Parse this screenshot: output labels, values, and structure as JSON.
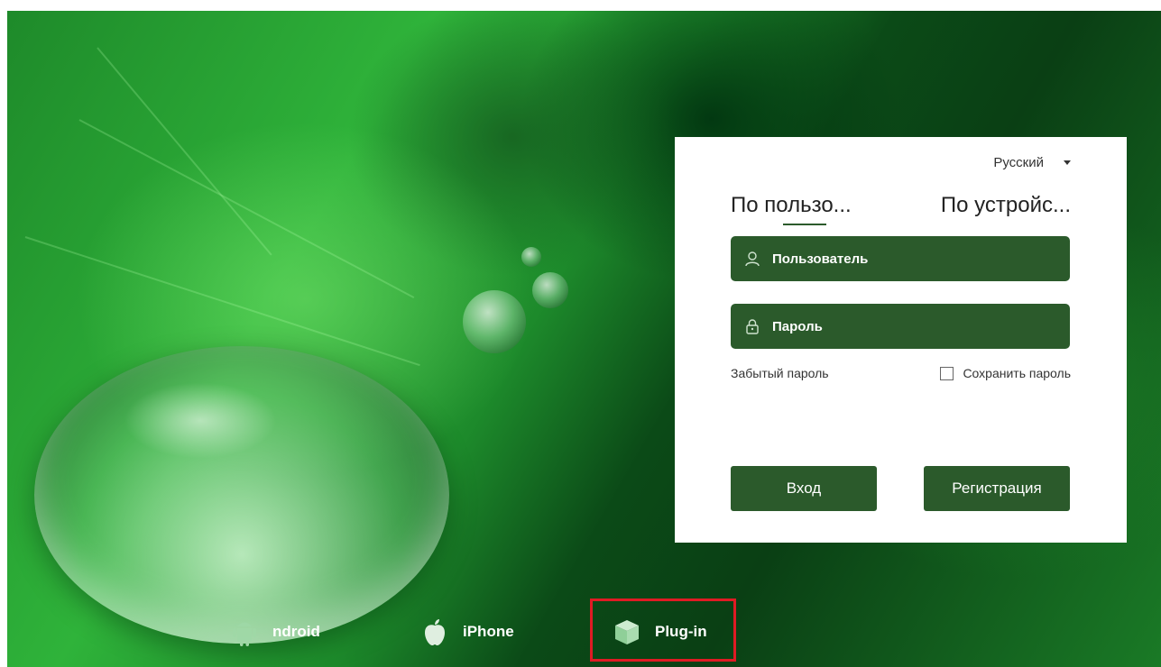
{
  "language": {
    "selected": "Русский"
  },
  "tabs": [
    {
      "label": "По пользо...",
      "active": true
    },
    {
      "label": "По устройс...",
      "active": false
    }
  ],
  "fields": {
    "username_placeholder": "Пользователь",
    "password_placeholder": "Пароль"
  },
  "options": {
    "forgot_password": "Забытый пароль",
    "save_password": "Сохранить пароль",
    "save_password_checked": false
  },
  "buttons": {
    "login": "Вход",
    "register": "Регистрация"
  },
  "downloads": [
    {
      "label": "ndroid",
      "icon": "android-icon"
    },
    {
      "label": "iPhone",
      "icon": "apple-icon"
    },
    {
      "label": "Plug-in",
      "icon": "plugin-cube-icon"
    }
  ],
  "colors": {
    "accent": "#2b5a2b",
    "highlight": "#e01b24"
  }
}
